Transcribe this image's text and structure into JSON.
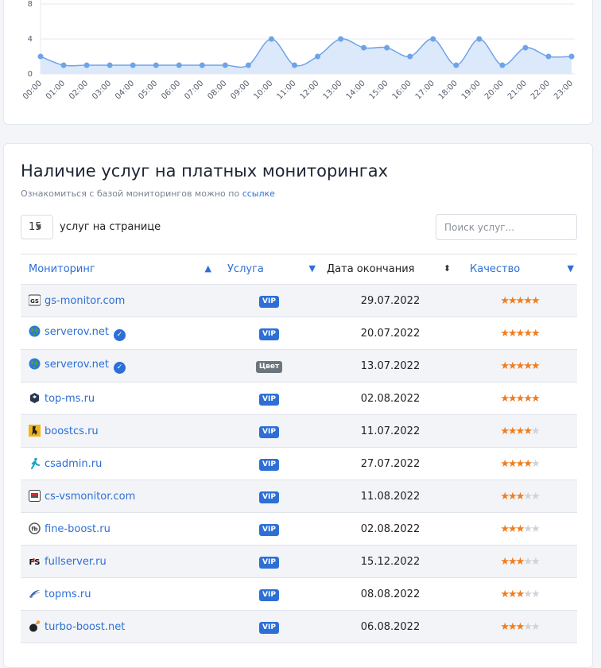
{
  "chart": {
    "colors": {
      "line": "#6ea3ea",
      "fill": "#dce9fb",
      "grid": "#e7eaf0"
    }
  },
  "chart_data": {
    "type": "area",
    "x": [
      "00:00",
      "01:00",
      "02:00",
      "03:00",
      "04:00",
      "05:00",
      "06:00",
      "07:00",
      "08:00",
      "09:00",
      "10:00",
      "11:00",
      "12:00",
      "13:00",
      "14:00",
      "15:00",
      "16:00",
      "17:00",
      "18:00",
      "19:00",
      "20:00",
      "21:00",
      "22:00",
      "23:00"
    ],
    "values": [
      2,
      1,
      1,
      1,
      1,
      1,
      1,
      1,
      1,
      1,
      4,
      1,
      2,
      4,
      3,
      3,
      2,
      4,
      1,
      4,
      1,
      3,
      2,
      2
    ],
    "y_ticks": [
      "0",
      "4",
      "8"
    ],
    "ylim": [
      0,
      8
    ],
    "grid": true
  },
  "services": {
    "title": "Наличие услуг на платных мониторингах",
    "subtitle_text": "Ознакомиться с базой мониторингов можно по ",
    "subtitle_link": "ссылке",
    "per_page_value": "15",
    "per_page_label": "услуг на странице",
    "search_placeholder": "Поиск услуг...",
    "columns": {
      "monitoring": "Мониторинг",
      "service": "Услуга",
      "end_date": "Дата окончания",
      "quality": "Качество"
    },
    "rows": [
      {
        "icon": "gs-icon",
        "name": "gs-monitor.com",
        "verified": false,
        "service": "VIP",
        "date": "29.07.2022",
        "stars": 5
      },
      {
        "icon": "globe-icon",
        "name": "serverov.net",
        "verified": true,
        "service": "VIP",
        "date": "20.07.2022",
        "stars": 5
      },
      {
        "icon": "globe-icon",
        "name": "serverov.net",
        "verified": true,
        "service": "Цвет",
        "date": "13.07.2022",
        "stars": 5
      },
      {
        "icon": "cube-icon",
        "name": "top-ms.ru",
        "verified": false,
        "service": "VIP",
        "date": "02.08.2022",
        "stars": 5
      },
      {
        "icon": "cs-icon",
        "name": "boostcs.ru",
        "verified": false,
        "service": "VIP",
        "date": "11.07.2022",
        "stars": 4
      },
      {
        "icon": "runner-icon",
        "name": "csadmin.ru",
        "verified": false,
        "service": "VIP",
        "date": "27.07.2022",
        "stars": 4
      },
      {
        "icon": "monitor-icon",
        "name": "cs-vsmonitor.com",
        "verified": false,
        "service": "VIP",
        "date": "11.08.2022",
        "stars": 3
      },
      {
        "icon": "fb-icon",
        "name": "fine-boost.ru",
        "verified": false,
        "service": "VIP",
        "date": "02.08.2022",
        "stars": 3
      },
      {
        "icon": "fs-icon",
        "name": "fullserver.ru",
        "verified": false,
        "service": "VIP",
        "date": "15.12.2022",
        "stars": 3
      },
      {
        "icon": "swoosh-icon",
        "name": "topms.ru",
        "verified": false,
        "service": "VIP",
        "date": "08.08.2022",
        "stars": 3
      },
      {
        "icon": "bomb-icon",
        "name": "turbo-boost.net",
        "verified": false,
        "service": "VIP",
        "date": "06.08.2022",
        "stars": 3
      }
    ]
  }
}
